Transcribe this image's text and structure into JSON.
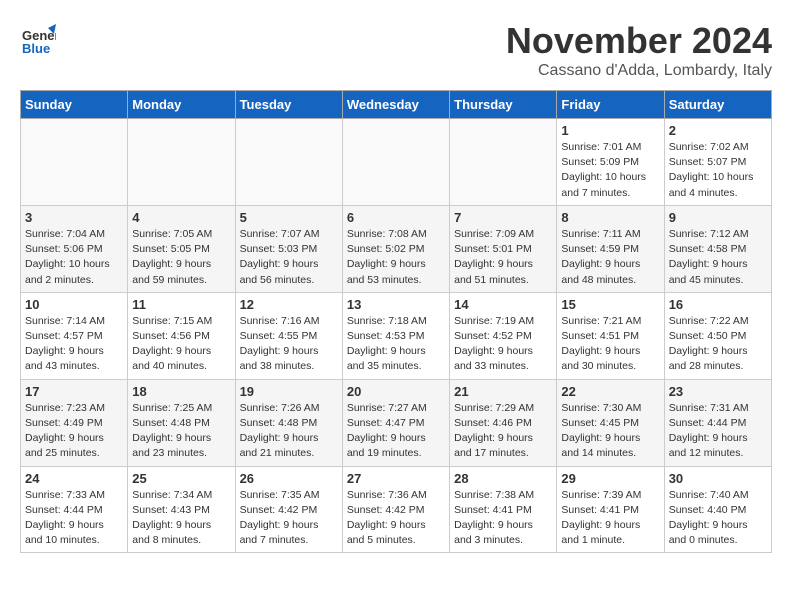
{
  "header": {
    "logo_general": "General",
    "logo_blue": "Blue",
    "month_title": "November 2024",
    "location": "Cassano d'Adda, Lombardy, Italy"
  },
  "days_of_week": [
    "Sunday",
    "Monday",
    "Tuesday",
    "Wednesday",
    "Thursday",
    "Friday",
    "Saturday"
  ],
  "weeks": [
    [
      {
        "day": "",
        "data": ""
      },
      {
        "day": "",
        "data": ""
      },
      {
        "day": "",
        "data": ""
      },
      {
        "day": "",
        "data": ""
      },
      {
        "day": "",
        "data": ""
      },
      {
        "day": "1",
        "data": "Sunrise: 7:01 AM\nSunset: 5:09 PM\nDaylight: 10 hours\nand 7 minutes."
      },
      {
        "day": "2",
        "data": "Sunrise: 7:02 AM\nSunset: 5:07 PM\nDaylight: 10 hours\nand 4 minutes."
      }
    ],
    [
      {
        "day": "3",
        "data": "Sunrise: 7:04 AM\nSunset: 5:06 PM\nDaylight: 10 hours\nand 2 minutes."
      },
      {
        "day": "4",
        "data": "Sunrise: 7:05 AM\nSunset: 5:05 PM\nDaylight: 9 hours\nand 59 minutes."
      },
      {
        "day": "5",
        "data": "Sunrise: 7:07 AM\nSunset: 5:03 PM\nDaylight: 9 hours\nand 56 minutes."
      },
      {
        "day": "6",
        "data": "Sunrise: 7:08 AM\nSunset: 5:02 PM\nDaylight: 9 hours\nand 53 minutes."
      },
      {
        "day": "7",
        "data": "Sunrise: 7:09 AM\nSunset: 5:01 PM\nDaylight: 9 hours\nand 51 minutes."
      },
      {
        "day": "8",
        "data": "Sunrise: 7:11 AM\nSunset: 4:59 PM\nDaylight: 9 hours\nand 48 minutes."
      },
      {
        "day": "9",
        "data": "Sunrise: 7:12 AM\nSunset: 4:58 PM\nDaylight: 9 hours\nand 45 minutes."
      }
    ],
    [
      {
        "day": "10",
        "data": "Sunrise: 7:14 AM\nSunset: 4:57 PM\nDaylight: 9 hours\nand 43 minutes."
      },
      {
        "day": "11",
        "data": "Sunrise: 7:15 AM\nSunset: 4:56 PM\nDaylight: 9 hours\nand 40 minutes."
      },
      {
        "day": "12",
        "data": "Sunrise: 7:16 AM\nSunset: 4:55 PM\nDaylight: 9 hours\nand 38 minutes."
      },
      {
        "day": "13",
        "data": "Sunrise: 7:18 AM\nSunset: 4:53 PM\nDaylight: 9 hours\nand 35 minutes."
      },
      {
        "day": "14",
        "data": "Sunrise: 7:19 AM\nSunset: 4:52 PM\nDaylight: 9 hours\nand 33 minutes."
      },
      {
        "day": "15",
        "data": "Sunrise: 7:21 AM\nSunset: 4:51 PM\nDaylight: 9 hours\nand 30 minutes."
      },
      {
        "day": "16",
        "data": "Sunrise: 7:22 AM\nSunset: 4:50 PM\nDaylight: 9 hours\nand 28 minutes."
      }
    ],
    [
      {
        "day": "17",
        "data": "Sunrise: 7:23 AM\nSunset: 4:49 PM\nDaylight: 9 hours\nand 25 minutes."
      },
      {
        "day": "18",
        "data": "Sunrise: 7:25 AM\nSunset: 4:48 PM\nDaylight: 9 hours\nand 23 minutes."
      },
      {
        "day": "19",
        "data": "Sunrise: 7:26 AM\nSunset: 4:48 PM\nDaylight: 9 hours\nand 21 minutes."
      },
      {
        "day": "20",
        "data": "Sunrise: 7:27 AM\nSunset: 4:47 PM\nDaylight: 9 hours\nand 19 minutes."
      },
      {
        "day": "21",
        "data": "Sunrise: 7:29 AM\nSunset: 4:46 PM\nDaylight: 9 hours\nand 17 minutes."
      },
      {
        "day": "22",
        "data": "Sunrise: 7:30 AM\nSunset: 4:45 PM\nDaylight: 9 hours\nand 14 minutes."
      },
      {
        "day": "23",
        "data": "Sunrise: 7:31 AM\nSunset: 4:44 PM\nDaylight: 9 hours\nand 12 minutes."
      }
    ],
    [
      {
        "day": "24",
        "data": "Sunrise: 7:33 AM\nSunset: 4:44 PM\nDaylight: 9 hours\nand 10 minutes."
      },
      {
        "day": "25",
        "data": "Sunrise: 7:34 AM\nSunset: 4:43 PM\nDaylight: 9 hours\nand 8 minutes."
      },
      {
        "day": "26",
        "data": "Sunrise: 7:35 AM\nSunset: 4:42 PM\nDaylight: 9 hours\nand 7 minutes."
      },
      {
        "day": "27",
        "data": "Sunrise: 7:36 AM\nSunset: 4:42 PM\nDaylight: 9 hours\nand 5 minutes."
      },
      {
        "day": "28",
        "data": "Sunrise: 7:38 AM\nSunset: 4:41 PM\nDaylight: 9 hours\nand 3 minutes."
      },
      {
        "day": "29",
        "data": "Sunrise: 7:39 AM\nSunset: 4:41 PM\nDaylight: 9 hours\nand 1 minute."
      },
      {
        "day": "30",
        "data": "Sunrise: 7:40 AM\nSunset: 4:40 PM\nDaylight: 9 hours\nand 0 minutes."
      }
    ]
  ]
}
